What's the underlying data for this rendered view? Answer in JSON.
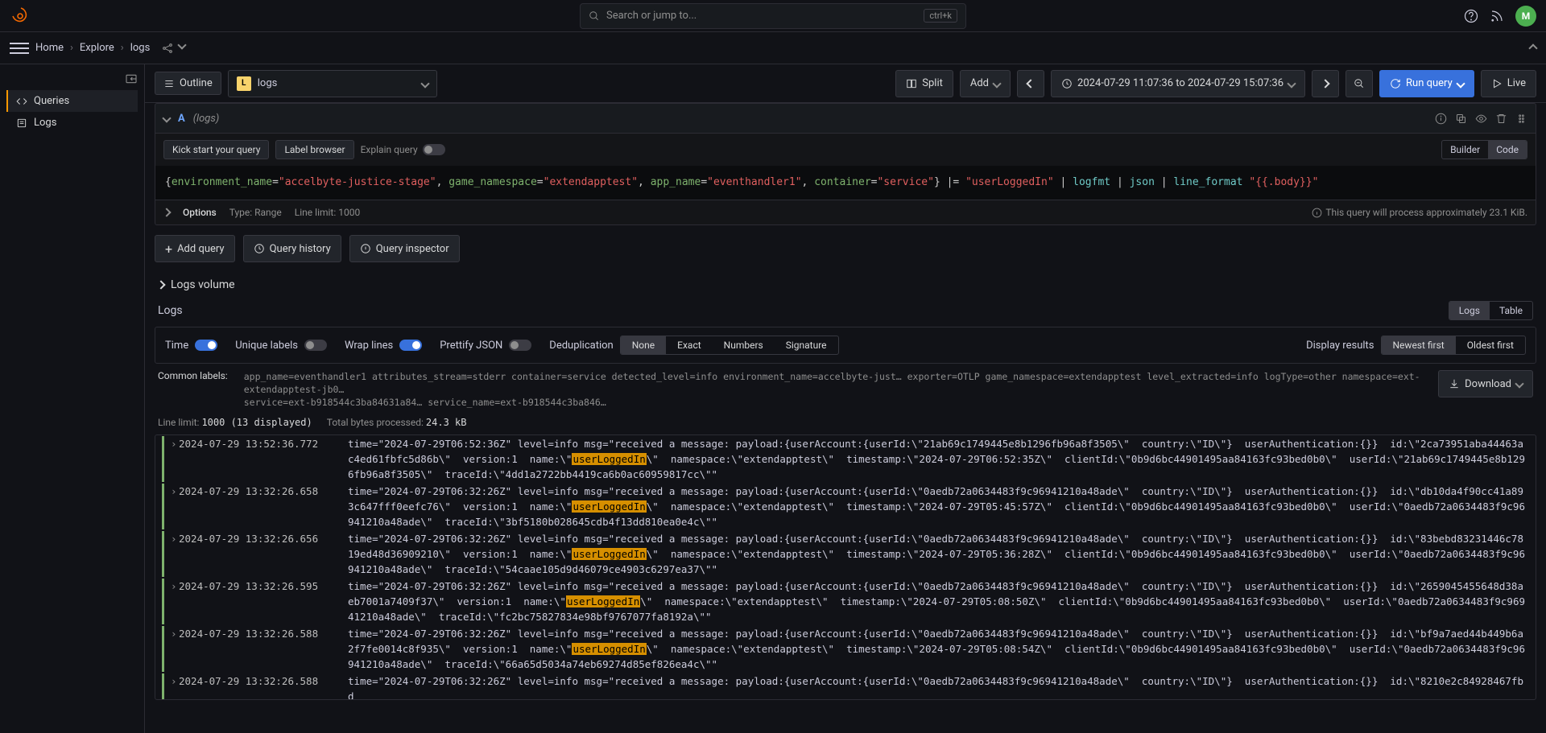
{
  "topbar": {
    "search_placeholder": "Search or jump to...",
    "kbd": "ctrl+k",
    "avatar_initial": "M"
  },
  "breadcrumb": {
    "home": "Home",
    "explore": "Explore",
    "page": "logs"
  },
  "sidebar": {
    "outline": "Outline",
    "items": [
      {
        "label": "Queries",
        "active": true
      },
      {
        "label": "Logs",
        "active": false
      }
    ]
  },
  "datasource": {
    "name": "logs"
  },
  "toolbar": {
    "split": "Split",
    "add": "Add",
    "timerange": "2024-07-29 11:07:36 to 2024-07-29 15:07:36",
    "run_query": "Run query",
    "live": "Live"
  },
  "query": {
    "id": "A",
    "ds_label": "(logs)",
    "kick_start": "Kick start your query",
    "label_browser": "Label browser",
    "explain": "Explain query",
    "builder": "Builder",
    "code": "Code",
    "options": "Options",
    "type": "Type: Range",
    "limit": "Line limit: 1000",
    "approx": "This query will process approximately 23.1 KiB.",
    "logql": {
      "open": "{",
      "k1": "environment_name",
      "v1": "\"accelbyte-justice-stage\"",
      "k2": "game_namespace",
      "v2": "\"extendapptest\"",
      "k3": "app_name",
      "v3": "\"eventhandler1\"",
      "k4": "container",
      "v4": "\"service\"",
      "close": "}",
      "pipe_eq": "|= ",
      "search": "\"userLoggedIn\"",
      "p1": "logfmt",
      "p2": "json",
      "p3": "line_format",
      "fmt": "\"{{.body}}\""
    }
  },
  "actions": {
    "add_query": "Add query",
    "history": "Query history",
    "inspector": "Query inspector"
  },
  "sections": {
    "volume": "Logs volume",
    "logs": "Logs",
    "tab_logs": "Logs",
    "tab_table": "Table"
  },
  "controls": {
    "time": "Time",
    "unique": "Unique labels",
    "wrap": "Wrap lines",
    "prettify": "Prettify JSON",
    "dedup": "Deduplication",
    "dedup_opts": [
      "None",
      "Exact",
      "Numbers",
      "Signature"
    ],
    "display_results": "Display results",
    "order_opts": [
      "Newest first",
      "Oldest first"
    ]
  },
  "labels": {
    "title": "Common labels:",
    "vals1": "app_name=eventhandler1  attributes_stream=stderr  container=service  detected_level=info  environment_name=accelbyte-just…  exporter=OTLP  game_namespace=extendapptest  level_extracted=info  logType=other  namespace=ext-extendapptest-jb0…",
    "vals2": "service=ext-b918544c3ba84631a84…  service_name=ext-b918544c3ba846…"
  },
  "limits": {
    "line_limit_label": "Line limit:",
    "line_limit": "1000 (13 displayed)",
    "bytes_label": "Total bytes processed:",
    "bytes": "24.3 kB"
  },
  "download": "Download",
  "logs": [
    {
      "ts": "2024-07-29 13:52:36.772",
      "pre": "time=\"2024-07-29T06:52:36Z\" level=info msg=\"received a message: payload:{userAccount:{userId:\\\"21ab69c1749445e8b1296fb96a8f3505\\\"  country:\\\"ID\\\"}  userAuthentication:{}}  id:\\\"2ca73951aba44463ac4ed61fbfc5d86b\\\"  version:1  name:\\\"",
      "hl": "userLoggedIn",
      "post": "\\\"  namespace:\\\"extendapptest\\\"  timestamp:\\\"2024-07-29T06:52:35Z\\\"  clientId:\\\"0b9d6bc44901495aa84163fc93bed0b0\\\"  userId:\\\"21ab69c1749445e8b1296fb96a8f3505\\\"  traceId:\\\"4dd1a2722bb4419ca6b0ac60959817cc\\\"\""
    },
    {
      "ts": "2024-07-29 13:32:26.658",
      "pre": "time=\"2024-07-29T06:32:26Z\" level=info msg=\"received a message: payload:{userAccount:{userId:\\\"0aedb72a0634483f9c96941210a48ade\\\"  country:\\\"ID\\\"}  userAuthentication:{}}  id:\\\"db10da4f90cc41a893c647fff0eefc76\\\"  version:1  name:\\\"",
      "hl": "userLoggedIn",
      "post": "\\\"  namespace:\\\"extendapptest\\\"  timestamp:\\\"2024-07-29T05:45:57Z\\\"  clientId:\\\"0b9d6bc44901495aa84163fc93bed0b0\\\"  userId:\\\"0aedb72a0634483f9c96941210a48ade\\\"  traceId:\\\"3bf5180b028645cdb4f13dd810ea0e4c\\\"\""
    },
    {
      "ts": "2024-07-29 13:32:26.656",
      "pre": "time=\"2024-07-29T06:32:26Z\" level=info msg=\"received a message: payload:{userAccount:{userId:\\\"0aedb72a0634483f9c96941210a48ade\\\"  country:\\\"ID\\\"}  userAuthentication:{}}  id:\\\"83bebd83231446c7819ed48d36909210\\\"  version:1  name:\\\"",
      "hl": "userLoggedIn",
      "post": "\\\"  namespace:\\\"extendapptest\\\"  timestamp:\\\"2024-07-29T05:36:28Z\\\"  clientId:\\\"0b9d6bc44901495aa84163fc93bed0b0\\\"  userId:\\\"0aedb72a0634483f9c96941210a48ade\\\"  traceId:\\\"54caae105d9d46079ce4903c6297ea37\\\"\""
    },
    {
      "ts": "2024-07-29 13:32:26.595",
      "pre": "time=\"2024-07-29T06:32:26Z\" level=info msg=\"received a message: payload:{userAccount:{userId:\\\"0aedb72a0634483f9c96941210a48ade\\\"  country:\\\"ID\\\"}  userAuthentication:{}}  id:\\\"2659045455648d38aeb7001a7409f37\\\"  version:1  name:\\\"",
      "hl": "userLoggedIn",
      "post": "\\\"  namespace:\\\"extendapptest\\\"  timestamp:\\\"2024-07-29T05:08:50Z\\\"  clientId:\\\"0b9d6bc44901495aa84163fc93bed0b0\\\"  userId:\\\"0aedb72a0634483f9c96941210a48ade\\\"  traceId:\\\"fc2bc75827834e98bf9767077fa8192a\\\"\""
    },
    {
      "ts": "2024-07-29 13:32:26.588",
      "pre": "time=\"2024-07-29T06:32:26Z\" level=info msg=\"received a message: payload:{userAccount:{userId:\\\"0aedb72a0634483f9c96941210a48ade\\\"  country:\\\"ID\\\"}  userAuthentication:{}}  id:\\\"bf9a7aed44b449b6a2f7fe0014c8f935\\\"  version:1  name:\\\"",
      "hl": "userLoggedIn",
      "post": "\\\"  namespace:\\\"extendapptest\\\"  timestamp:\\\"2024-07-29T05:08:54Z\\\"  clientId:\\\"0b9d6bc44901495aa84163fc93bed0b0\\\"  userId:\\\"0aedb72a0634483f9c96941210a48ade\\\"  traceId:\\\"66a65d5034a74eb69274d85ef826ea4c\\\"\""
    },
    {
      "ts": "2024-07-29 13:32:26.588",
      "pre": "time=\"2024-07-29T06:32:26Z\" level=info msg=\"received a message: payload:{userAccount:{userId:\\\"0aedb72a0634483f9c96941210a48ade\\\"  country:\\\"ID\\\"}  userAuthentication:{}}  id:\\\"8210e2c84928467fbd",
      "hl": "",
      "post": ""
    }
  ]
}
